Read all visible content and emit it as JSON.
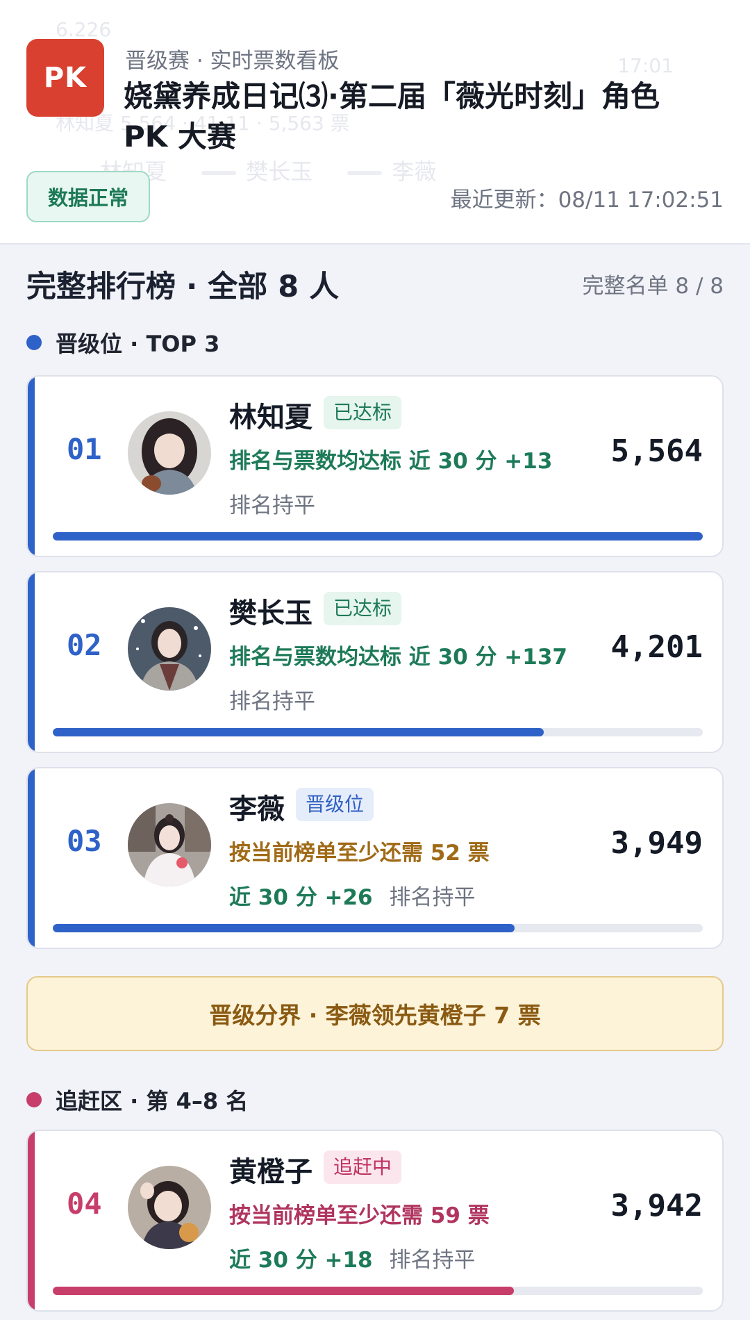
{
  "header": {
    "logo_text": "PK",
    "subtitle": "晋级赛 · 实时票数看板",
    "title": "娆黛养成日记⑶·第二届「薇光时刻」角色 PK 大赛",
    "status": "数据正常",
    "updated": "最近更新：08/11 17:02:51",
    "ghost": {
      "top_left": "6.226",
      "top_right": "17:01",
      "middle": "林知夏 5,564 · 41.11 · 5,563 票",
      "legend": [
        "林知夏",
        "樊长玉",
        "李薇"
      ]
    }
  },
  "ranking": {
    "title": "完整排行榜 · 全部 8 人",
    "count": "完整名单 8 / 8"
  },
  "groups": {
    "top": {
      "label": "晋级位 · TOP 3",
      "color": "#2f62c8"
    },
    "chase": {
      "label": "追赶区 · 第 4–8 名",
      "color": "#c73e6b"
    }
  },
  "cards": [
    {
      "rank": "01",
      "name": "林知夏",
      "badge": "已达标",
      "line1": "排名与票数均达标  近 30 分 +13",
      "line2": "排名持平",
      "votes": "5,564",
      "progress": 1.0
    },
    {
      "rank": "02",
      "name": "樊长玉",
      "badge": "已达标",
      "line1": "排名与票数均达标  近 30 分 +137",
      "line2": "排名持平",
      "votes": "4,201",
      "progress": 0.755
    },
    {
      "rank": "03",
      "name": "李薇",
      "badge": "晋级位",
      "line1": "按当前榜单至少还需 52 票",
      "line2a": "近 30 分 +26",
      "line2b": "排名持平",
      "votes": "3,949",
      "progress": 0.71
    },
    {
      "rank": "04",
      "name": "黄橙子",
      "badge": "追赶中",
      "line1": "按当前榜单至少还需 59 票",
      "line2a": "近 30 分 +18",
      "line2b": "排名持平",
      "votes": "3,942",
      "progress": 0.709
    }
  ],
  "divider": "晋级分界 · 李薇领先黄橙子 7 票",
  "colors": {
    "brand_red": "#d9402f",
    "top_accent": "#2f62c8",
    "chase_accent": "#c73e6b",
    "ok_green": "#1d7a58",
    "need_gold": "#a06a16"
  }
}
